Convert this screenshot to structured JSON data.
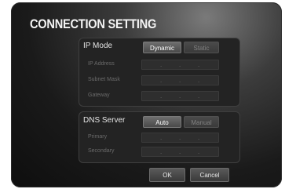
{
  "title": "CONNECTION SETTING",
  "ip_mode": {
    "label": "IP Mode",
    "options": [
      "Dynamic",
      "Static"
    ],
    "selected": "Dynamic",
    "fields": [
      {
        "label": "IP Address",
        "separators": [
          ".",
          ".",
          "."
        ]
      },
      {
        "label": "Subnet Mask",
        "separators": [
          ".",
          ".",
          "."
        ]
      },
      {
        "label": "Gateway",
        "separators": [
          ".",
          ".",
          "."
        ]
      }
    ]
  },
  "dns": {
    "label": "DNS Server",
    "options": [
      "Auto",
      "Manual"
    ],
    "selected": "Auto",
    "fields": [
      {
        "label": "Primary",
        "separators": [
          ".",
          ".",
          "."
        ]
      },
      {
        "label": "Secondary",
        "separators": [
          ".",
          ".",
          "."
        ]
      }
    ]
  },
  "actions": {
    "ok": "OK",
    "cancel": "Cancel"
  }
}
